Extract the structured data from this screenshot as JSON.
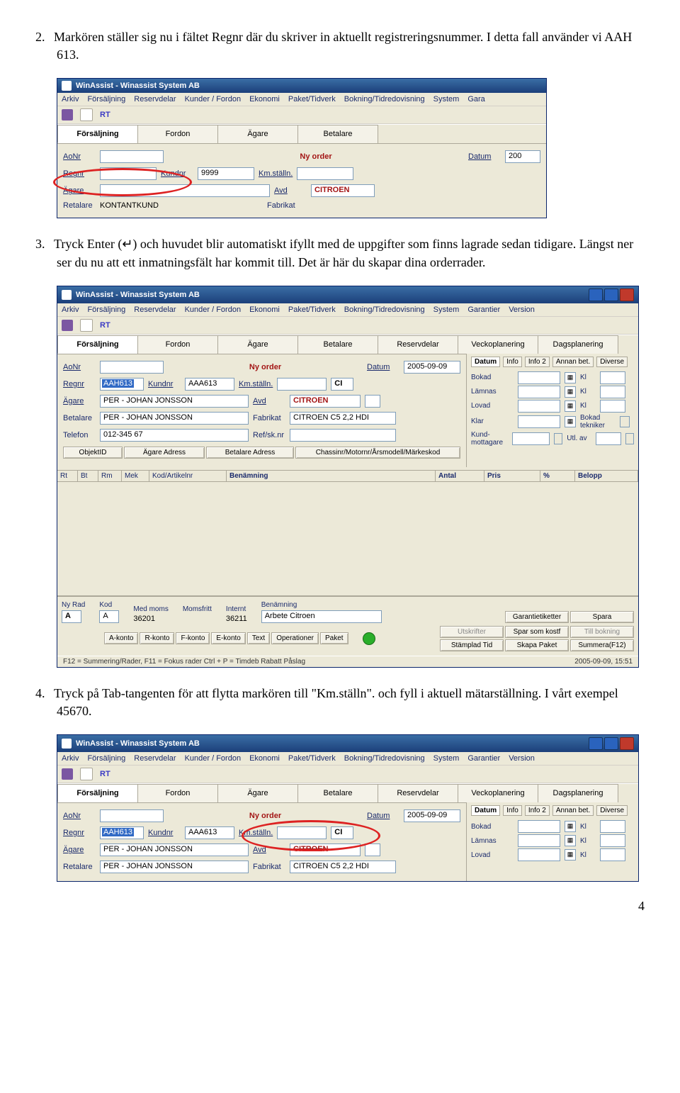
{
  "instructions": {
    "step2_num": "2.",
    "step2": "Markören ställer sig nu i fältet Regnr där du skriver in aktuellt registreringsnummer. I detta fall använder vi AAH 613.",
    "step3_num": "3.",
    "step3a": "Tryck Enter (",
    "step3_glyph": "↵",
    "step3b": ") och huvudet blir automatiskt ifyllt med de uppgifter som finns lagrade sedan tidigare. Längst ner ser du nu att ett inmatningsfält har kommit till. Det är här du skapar dina orderrader.",
    "step4_num": "4.",
    "step4": "Tryck på Tab-tangenten för att flytta markören till \"Km.ställn\". och fyll i aktuell mätarställning. I vårt exempel 45670."
  },
  "app_title": "WinAssist - Winassist System AB",
  "menus": [
    "Arkiv",
    "Försäljning",
    "Reservdelar",
    "Kunder / Fordon",
    "Ekonomi",
    "Paket/Tidverk",
    "Bokning/Tidredovisning",
    "System",
    "Garantier",
    "Version"
  ],
  "menus_short": [
    "Arkiv",
    "Försäljning",
    "Reservdelar",
    "Kunder / Fordon",
    "Ekonomi",
    "Paket/Tidverk",
    "Bokning/Tidredovisning",
    "System",
    "Gara"
  ],
  "rt": "RT",
  "main_tabs_short": [
    "Försäljning",
    "Fordon",
    "Ägare",
    "Betalare"
  ],
  "main_tabs_full": [
    "Försäljning",
    "Fordon",
    "Ägare",
    "Betalare",
    "Reservdelar",
    "Veckoplanering",
    "Dagsplanering"
  ],
  "labels": {
    "aonr": "AoNr",
    "nyorder": "Ny order",
    "datum": "Datum",
    "datum_val": "200",
    "regnr": "Regnr",
    "kundnr": "Kundnr",
    "kundnr_val1": "9999",
    "kmstalln": "Km.ställn.",
    "agare": "Ägare",
    "avd": "Avd",
    "citroen": "CITROEN",
    "retalare": "Retalare",
    "kontant": "KONTANTKUND",
    "fabrikat": "Fabrikat",
    "betalare": "Betalare",
    "telefon": "Telefon",
    "refsk": "Ref/sk.nr",
    "kundnr_val2": "AAA613",
    "regnr_val": "AAH613",
    "agare_val": "PER - JOHAN JONSSON",
    "fabrikat_val": "CITROEN C5 2,2 HDI",
    "telefon_val": "012-345 67",
    "datum_full": "2005-09-09",
    "ci": "CI"
  },
  "right": {
    "tabs": [
      "Datum",
      "Info",
      "Info 2",
      "Annan bet.",
      "Diverse"
    ],
    "rows": [
      "Bokad",
      "Lämnas",
      "Lovad",
      "Klar",
      "Kund-mottagare"
    ],
    "kl": "Kl",
    "bokad_tekniker": "Bokad tekniker",
    "utl": "Utl. av"
  },
  "sub_btns": [
    "ObjektID",
    "Ägare Adress",
    "Betalare Adress",
    "Chassinr/Motornr/Årsmodell/Märkeskod"
  ],
  "grid_cols": [
    "Rt",
    "Bt",
    "Rm",
    "Mek",
    "Kod/Artikelnr",
    "Benämning",
    "Antal",
    "Pris",
    "%",
    "Belopp"
  ],
  "bottom": {
    "nyrad": "Ny Rad",
    "kod": "Kod",
    "medmoms": "Med moms",
    "momsfritt": "Momsfritt",
    "internt": "Internt",
    "benamning": "Benämning",
    "a": "A",
    "v1": "36201",
    "v2": "36211",
    "arbete": "Arbete Citroen",
    "btns1": [
      "A-konto",
      "R-konto",
      "F-konto",
      "E-konto",
      "Text",
      "Operationer",
      "Paket"
    ],
    "right_buttons": [
      "Garantietiketter",
      "Spara",
      "Utskrifter",
      "Spar som kostf",
      "Till bokning",
      "Stämplad Tid",
      "Skapa Paket",
      "Summera(F12)"
    ]
  },
  "statusbar": {
    "left": "F12 = Summering/Rader, F11 = Fokus rader  Ctrl + P = Timdeb Rabatt Påslag",
    "right": "2005-09-09, 15:51"
  },
  "page": "4"
}
